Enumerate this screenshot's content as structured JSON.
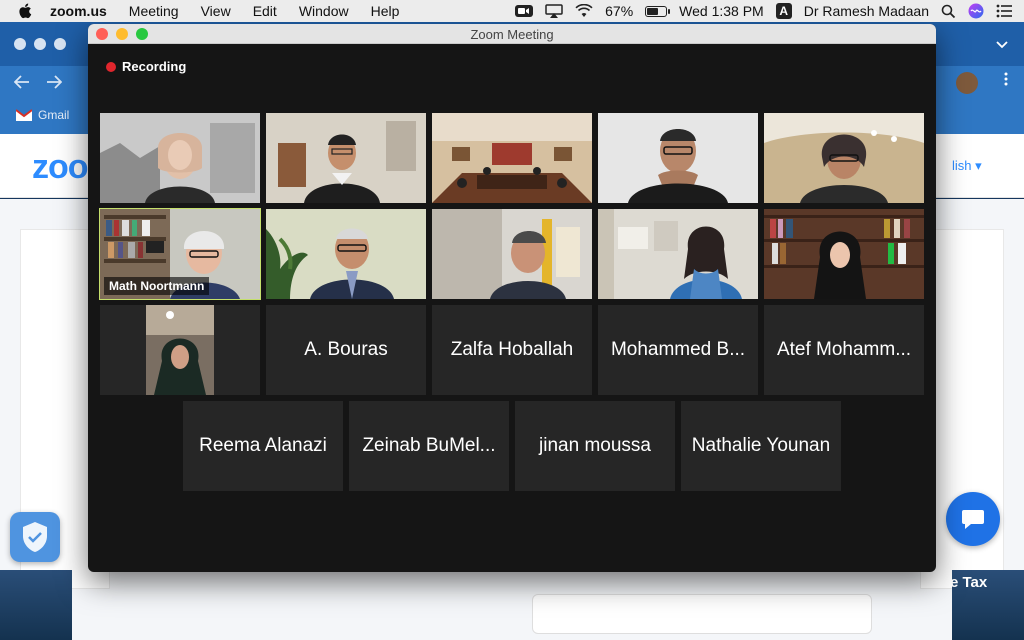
{
  "menubar": {
    "app_name": "zoom.us",
    "menus": [
      "Meeting",
      "View",
      "Edit",
      "Window",
      "Help"
    ],
    "battery": "67%",
    "battery_level": 0.67,
    "clock": "Wed 1:38 PM",
    "input_source": "A",
    "user": "Dr Ramesh Madaan",
    "icons": [
      "apple-icon",
      "zoom-icon",
      "airplay-icon",
      "wifi-icon",
      "battery-icon",
      "search-icon",
      "siri-icon",
      "control-center-icon"
    ]
  },
  "browser": {
    "bookmark": "Gmail",
    "site_logo": "zoo",
    "language_link": "lish ▾",
    "footer_text": "e Tax",
    "colors": {
      "tabstrip": "#1f5fa8",
      "toolbar": "#2f77c3",
      "zoom_blue": "#2d8cff"
    }
  },
  "zoom": {
    "window_title": "Zoom Meeting",
    "recording_label": "Recording",
    "active_speaker_color": "#c5e06c",
    "video_tiles": [
      {
        "id": "t1",
        "label": ""
      },
      {
        "id": "t2",
        "label": ""
      },
      {
        "id": "t3",
        "label": ""
      },
      {
        "id": "t4",
        "label": ""
      },
      {
        "id": "t5",
        "label": ""
      },
      {
        "id": "t6",
        "label": "Math Noortmann",
        "active": true
      },
      {
        "id": "t7",
        "label": ""
      },
      {
        "id": "t8",
        "label": ""
      },
      {
        "id": "t9",
        "label": ""
      },
      {
        "id": "t10",
        "label": ""
      },
      {
        "id": "t11",
        "label": ""
      }
    ],
    "name_tiles": [
      "A. Bouras",
      "Zalfa Hoballah",
      "Mohammed B...",
      "Atef Mohamm...",
      "Reema Alanazi",
      "Zeinab BuMel...",
      "jinan moussa",
      "Nathalie Younan"
    ]
  }
}
